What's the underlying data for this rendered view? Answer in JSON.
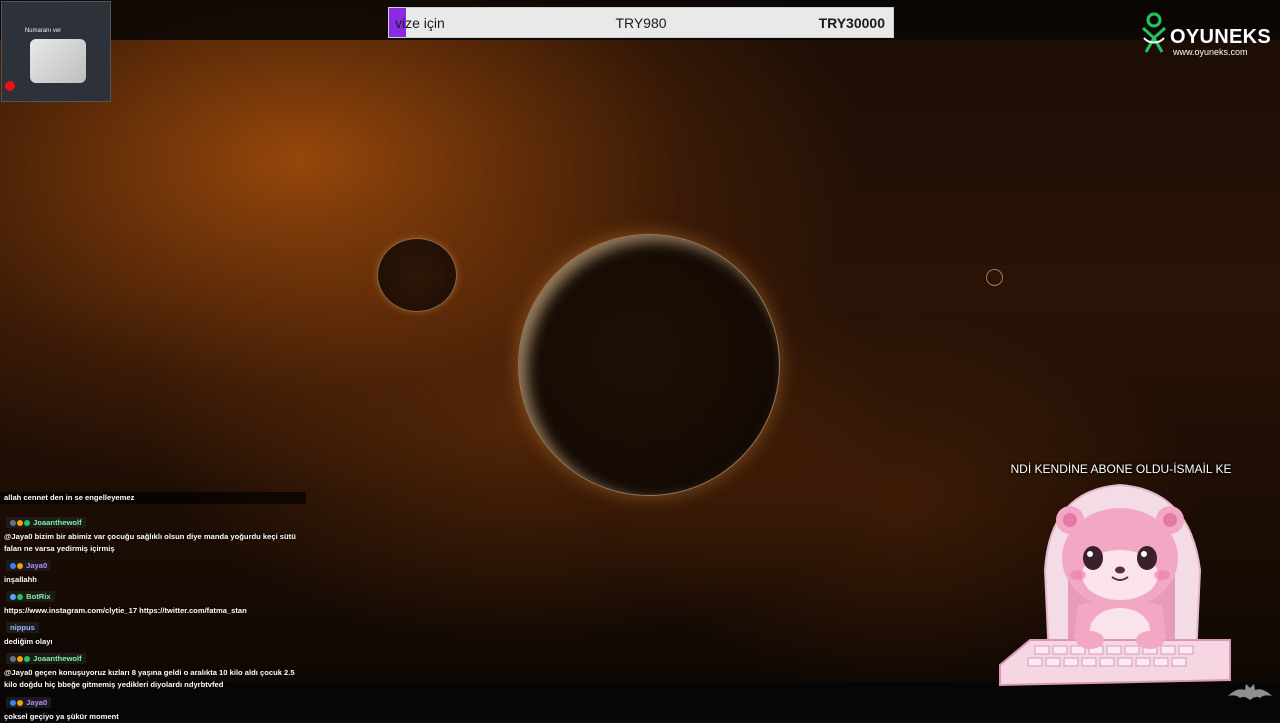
{
  "goal": {
    "name": "vize için",
    "current": "TRY980",
    "target": "TRY30000",
    "progress": 0.033,
    "accent_color": "#8a2be2"
  },
  "webcam": {
    "label": "Numaranı ver"
  },
  "logo": {
    "title": "OYUNEKS",
    "url": "www.oyuneks.com",
    "color": "#22c55e"
  },
  "chat": {
    "messages": [
      {
        "user": "",
        "text": "allah cennet den in se engelleyemez"
      },
      {
        "user": "Joaanthewolf",
        "user_color": "#7ef29d",
        "text": "@Jaya0 bizim bir abimiz var çocuğu sağlıklı olsun diye manda yoğurdu keçi sütü falan ne varsa yedirmiş içirmiş"
      },
      {
        "user": "Jaya0",
        "user_color": "#b98cff",
        "text": "inşallahh"
      },
      {
        "user": "BotRix",
        "user_color": "#7ef29d",
        "text": "https://www.instagram.com/clytie_17 https://twitter.com/fatma_stan"
      },
      {
        "user": "nippus",
        "user_color": "#9fb7ff",
        "text": "dediğim olayı"
      },
      {
        "user": "Joaanthewolf",
        "user_color": "#7ef29d",
        "text": "@Jaya0 geçen konuşuyoruz kızları 8 yaşına geldi o aralıkta 10 kilo aldı çocuk 2.5 kilo doğdu hiç bbeğe gitmemiş yedikleri diyolardı ndyrbtvfed"
      },
      {
        "user": "Jaya0",
        "user_color": "#b98cff",
        "text": "çoksel geçiyo ya şükür moment"
      }
    ]
  },
  "alert": {
    "text": "NDİ KENDİNE ABONE OLDU-İSMAİL KE"
  },
  "icons": {
    "logo": "oyuneks-logo-icon",
    "mascot": "otter-mascot-icon",
    "corner": "bat-icon"
  }
}
